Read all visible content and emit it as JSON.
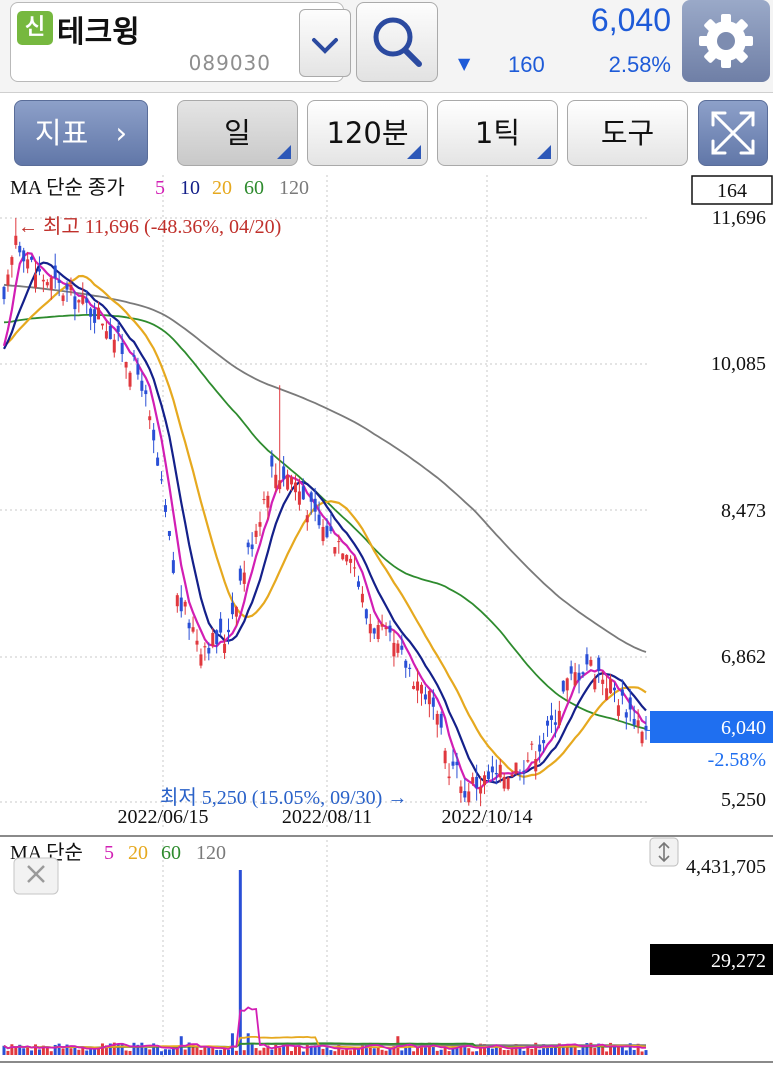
{
  "header": {
    "credit_badge": "신",
    "stock_name": "테크윙",
    "stock_code": "089030",
    "price": "6,040",
    "change": "160",
    "change_pct": "2.58%"
  },
  "toolbar": {
    "indicator_label": "지표",
    "period_label": "일",
    "minute_label": "120분",
    "tick_label": "1틱",
    "tools_label": "도구"
  },
  "colors": {
    "up": "#e0383e",
    "down": "#2a4fd6",
    "ma5": "#d21eb4",
    "ma10": "#14208a",
    "ma20": "#e6a91f",
    "ma60": "#2e8b2e",
    "ma120": "#7a7a7a",
    "current_price_bg": "#1f6ff0",
    "high_label": "#c0302b",
    "low_label": "#2a62c9"
  },
  "icons": {
    "dropdown": "chevron-down-icon",
    "search": "search-icon",
    "settings": "gear-icon",
    "expand": "expand-icon",
    "close": "close-icon",
    "resize": "resize-vertical-icon"
  },
  "chart_data": [
    {
      "type": "candlestick",
      "legend": {
        "prefix": "MA 단순 종가",
        "periods": [
          "5",
          "10",
          "20",
          "60",
          "120"
        ]
      },
      "count_box": "164",
      "y_ticks": [
        "11,696",
        "10,085",
        "8,473",
        "6,862",
        "5,250"
      ],
      "ylim": [
        5250,
        11696
      ],
      "x_ticks": [
        "2022/06/15",
        "2022/08/11",
        "2022/10/14"
      ],
      "current_price": "6,040",
      "current_change": "-2.58%",
      "high_note": "← 최고 11,696 (-48.36%, 04/20)",
      "low_note": "최저 5,250 (15.05%, 09/30) →",
      "high": 11696,
      "low": 5250,
      "last_close": 6040
    },
    {
      "type": "bar",
      "legend": {
        "prefix": "MA 단순",
        "periods": [
          "5",
          "20",
          "60",
          "120"
        ]
      },
      "y_labels": [
        "4,431,705",
        "29,272"
      ],
      "max_volume": 4431705
    }
  ]
}
